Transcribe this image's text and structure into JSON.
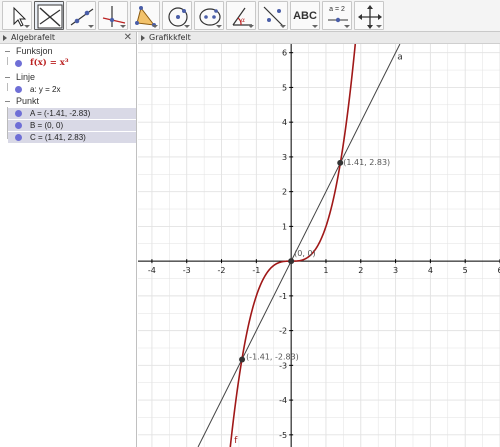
{
  "toolbar": {
    "tools": [
      {
        "name": "move-tool",
        "icon": "arrow-pointer-icon"
      },
      {
        "name": "graph-tool",
        "icon": "graph-icon"
      },
      {
        "name": "line-tool",
        "icon": "line-through-points-icon"
      },
      {
        "name": "perpendicular-tool",
        "icon": "perpendicular-line-icon"
      },
      {
        "name": "polygon-tool",
        "icon": "polygon-icon"
      },
      {
        "name": "circle-tool",
        "icon": "circle-center-point-icon"
      },
      {
        "name": "conic-tool",
        "icon": "ellipse-icon"
      },
      {
        "name": "angle-tool",
        "icon": "angle-icon"
      },
      {
        "name": "reflect-tool",
        "icon": "reflect-about-line-icon"
      },
      {
        "name": "text-tool",
        "icon": "text-icon",
        "label": "ABC"
      },
      {
        "name": "slider-tool",
        "icon": "slider-icon",
        "label": "a = 2"
      },
      {
        "name": "move-view-tool",
        "icon": "move-graphics-view-icon"
      }
    ]
  },
  "algebra": {
    "title": "Algebrafelt",
    "close": "✕",
    "categories": {
      "function": "Funksjon",
      "line": "Linje",
      "point": "Punkt"
    },
    "function_f": "f(x) = x³",
    "line_a": "a: y = 2x",
    "point_A": "A = (-1.41, -2.83)",
    "point_B": "B = (0, 0)",
    "point_C": "C = (1.41, 2.83)"
  },
  "graphics": {
    "title": "Grafikkfelt"
  },
  "colors": {
    "function": "#a01818",
    "line": "#444444",
    "point": "#333333",
    "point_dot_algebra": "#6f6fd6",
    "grid": "#e2e2e2",
    "axis": "#000000"
  },
  "chart_data": {
    "type": "line",
    "xlim": [
      -4.4,
      6.0
    ],
    "ylim": [
      -5.35,
      6.25
    ],
    "x_ticks": [
      -4,
      -3,
      -2,
      -1,
      1,
      2,
      3,
      4,
      5,
      6
    ],
    "y_ticks": [
      -5,
      -4,
      -3,
      -2,
      -1,
      1,
      2,
      3,
      4,
      5,
      6
    ],
    "grid": true,
    "series": [
      {
        "name": "f",
        "expression": "x^3"
      },
      {
        "name": "a",
        "expression": "2x"
      }
    ],
    "points": [
      {
        "name": "A",
        "x": -1.41,
        "y": -2.83,
        "label": "(-1.41, -2.83)"
      },
      {
        "name": "B",
        "x": 0,
        "y": 0,
        "label": "(0, 0)"
      },
      {
        "name": "C",
        "x": 1.41,
        "y": 2.83,
        "label": "(1.41, 2.83)"
      }
    ]
  }
}
